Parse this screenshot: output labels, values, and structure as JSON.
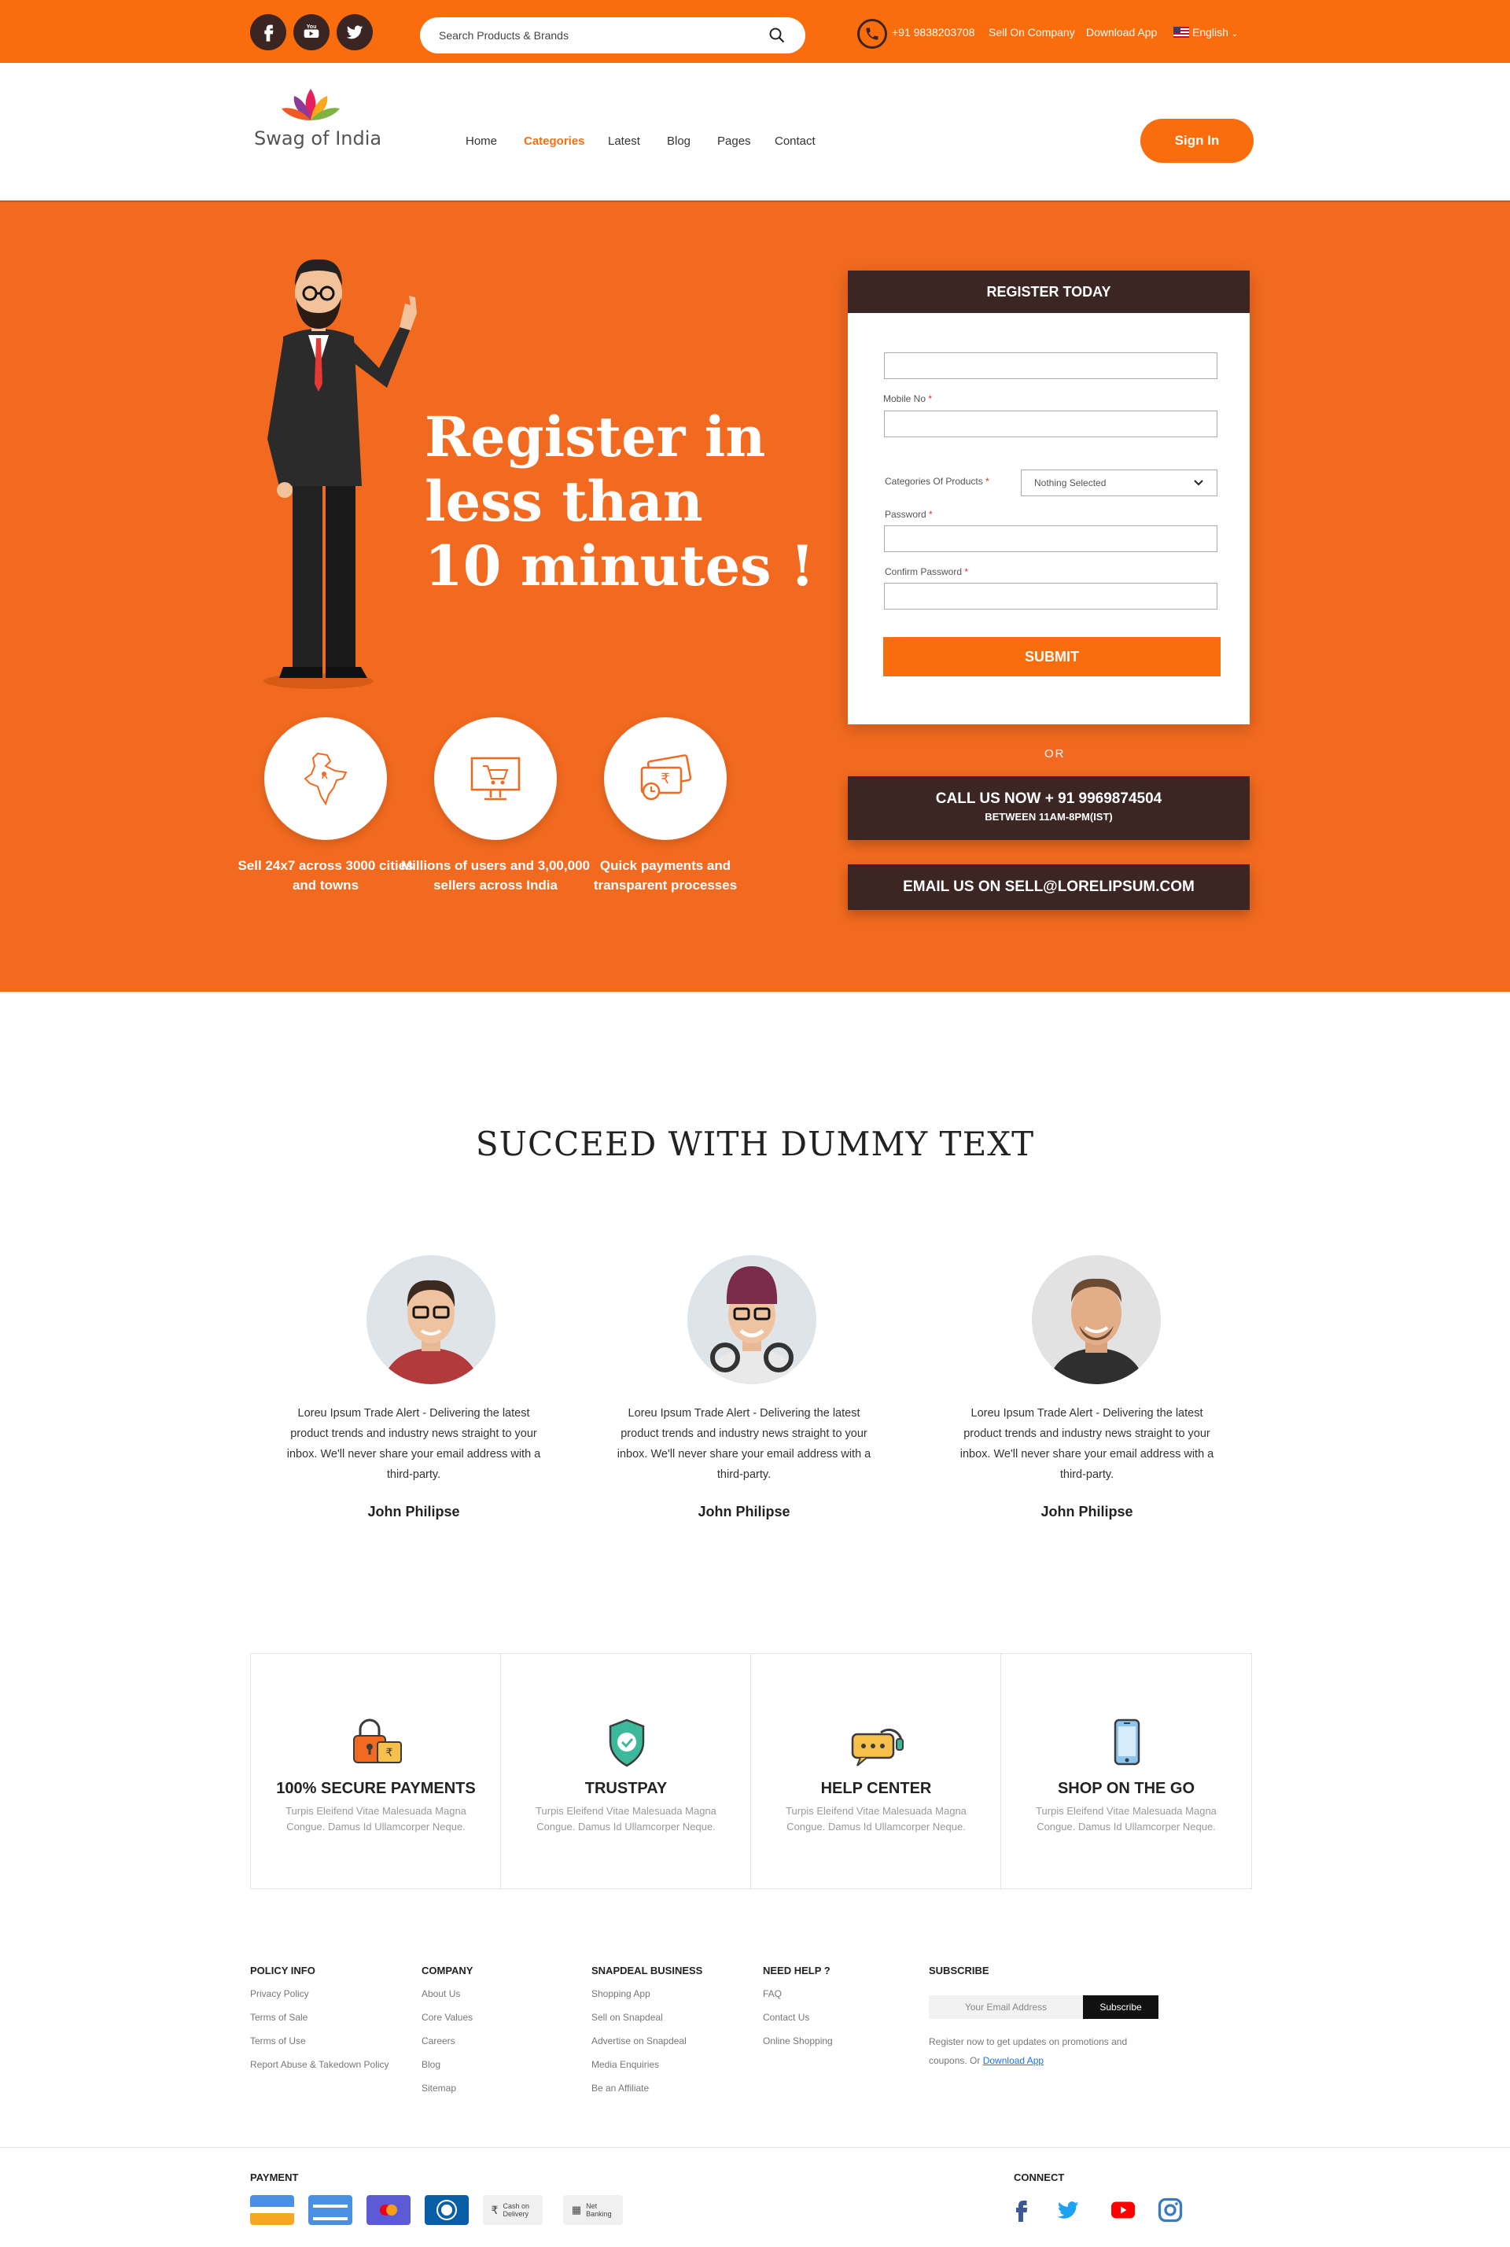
{
  "topbar": {
    "social": [
      "facebook-icon",
      "youtube-icon",
      "twitter-icon"
    ],
    "search_placeholder": "Search Products & Brands",
    "phone": "+91 9838203708",
    "sell_link": "Sell On Company",
    "download_link": "Download App",
    "language": "English"
  },
  "header": {
    "logo_text": "Swag of India",
    "nav": [
      "Home",
      "Categories",
      "Latest",
      "Blog",
      "Pages",
      "Contact"
    ],
    "active_nav": "Categories",
    "signin": "Sign In"
  },
  "hero": {
    "headline_1": "Register in",
    "headline_2": "less than",
    "headline_3": "10 minutes !",
    "features": [
      {
        "icon": "india-map-icon",
        "text": "Sell 24x7 across 3000 cities and towns"
      },
      {
        "icon": "monitor-cart-icon",
        "text": "Millions of users and 3,00,000 sellers across India"
      },
      {
        "icon": "rupee-card-clock-icon",
        "text": "Quick payments and transparent processes"
      }
    ]
  },
  "register": {
    "title": "REGISTER TODAY",
    "mobile_label": "Mobile No",
    "category_label": "Categories Of Products",
    "category_value": "Nothing Selected",
    "password_label": "Password",
    "confirm_label": "Confirm Password",
    "required_mark": "*",
    "submit": "SUBMIT",
    "or": "OR",
    "call_line1": "CALL US NOW + 91 9969874504",
    "call_line2": "BETWEEN 11AM-8PM(IST)",
    "email": "EMAIL US ON SELL@LORELIPSUM.COM"
  },
  "succeed": {
    "title": "SUCCEED WITH DUMMY TEXT",
    "testimonials": [
      {
        "text": "Loreu Ipsum Trade Alert - Delivering the latest product trends and industry news straight to your inbox. We'll never share your email address with a third-party.",
        "name": "John Philipse"
      },
      {
        "text": "Loreu Ipsum Trade Alert - Delivering the latest product trends and industry news straight to your inbox. We'll never share your email address with a third-party.",
        "name": "John Philipse"
      },
      {
        "text": "Loreu Ipsum Trade Alert - Delivering the latest product trends and industry news straight to your inbox. We'll never share your email address with a third-party.",
        "name": "John Philipse"
      }
    ]
  },
  "features": [
    {
      "icon": "lock-wallet-icon",
      "title": "100% SECURE PAYMENTS",
      "desc": "Turpis Eleifend Vitae Malesuada Magna Congue. Damus Id Ullamcorper Neque."
    },
    {
      "icon": "shield-check-icon",
      "title": "TRUSTPAY",
      "desc": "Turpis Eleifend Vitae Malesuada Magna Congue. Damus Id Ullamcorper Neque."
    },
    {
      "icon": "chat-headset-icon",
      "title": "HELP CENTER",
      "desc": "Turpis Eleifend Vitae Malesuada Magna Congue. Damus Id Ullamcorper Neque."
    },
    {
      "icon": "smartphone-icon",
      "title": "SHOP ON THE GO",
      "desc": "Turpis Eleifend Vitae Malesuada Magna Congue. Damus Id Ullamcorper Neque."
    }
  ],
  "footer": {
    "policy": {
      "title": "POLICY INFO",
      "links": [
        "Privacy Policy",
        "Terms of Sale",
        "Terms of Use",
        "Report Abuse & Takedown Policy"
      ]
    },
    "company": {
      "title": "COMPANY",
      "links": [
        "About Us",
        "Core Values",
        "Careers",
        "Blog",
        "Sitemap"
      ]
    },
    "business": {
      "title": "SNAPDEAL BUSINESS",
      "links": [
        "Shopping App",
        "Sell on Snapdeal",
        "Advertise on Snapdeal",
        "Media Enquiries",
        "Be an Affiliate"
      ]
    },
    "help": {
      "title": "NEED HELP ?",
      "links": [
        "FAQ",
        "Contact Us",
        "Online Shopping"
      ]
    },
    "subscribe": {
      "title": "SUBSCRIBE",
      "placeholder": "Your Email Address",
      "button": "Subscribe",
      "note": "Register now to get updates on promotions and coupons. Or",
      "note_link": "Download App"
    },
    "payment_title": "PAYMENT",
    "payment_methods": [
      "Cash on Delivery",
      "Net Banking"
    ],
    "connect_title": "CONNECT"
  },
  "colors": {
    "accent": "#fa6d0c",
    "dark": "#3b2623",
    "hero_bg": "#f26a1f"
  }
}
